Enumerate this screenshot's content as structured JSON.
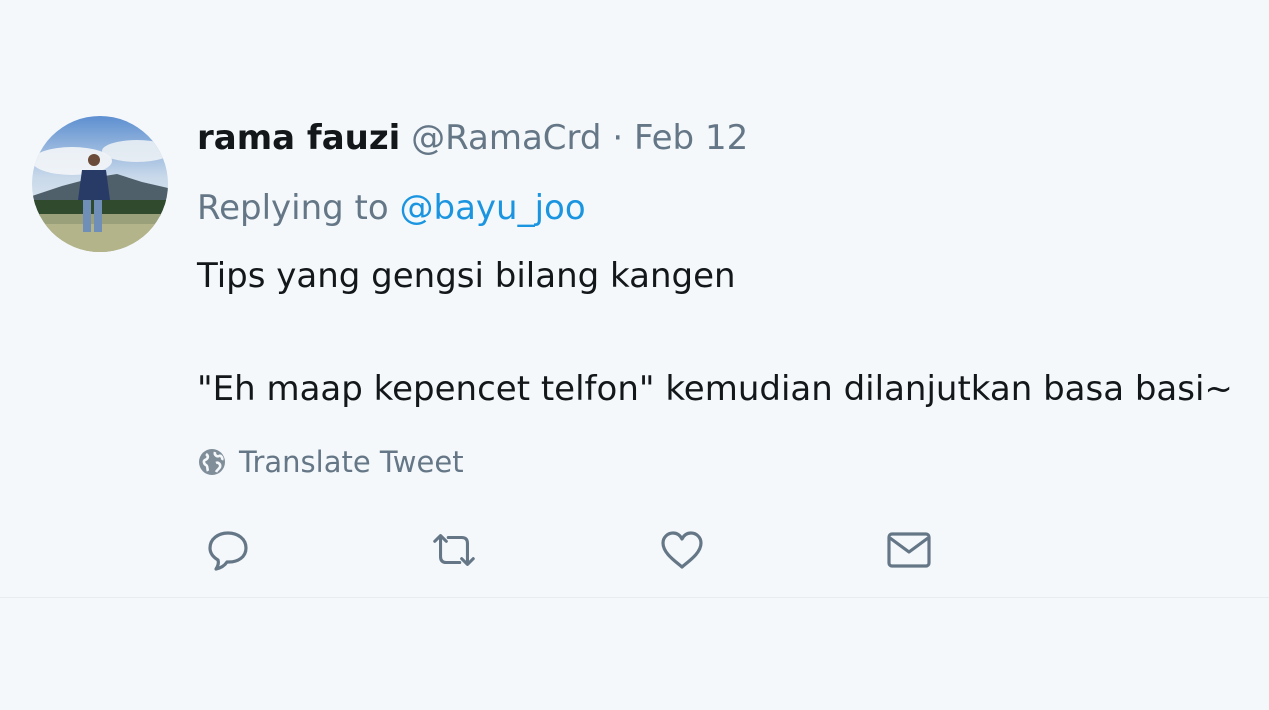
{
  "tweet": {
    "author_name": "rama fauzi",
    "author_handle": "@RamaCrd",
    "separator": "·",
    "date": "Feb 12",
    "reply_prefix": "Replying to",
    "reply_mention": "@bayu_joo",
    "text_line1": "Tips yang gengsi bilang kangen",
    "text_line2": "\"Eh maap kepencet telfon\" kemudian dilanjutkan basa basi~",
    "translate_label": "Translate Tweet"
  },
  "icons": {
    "translate": "globe-icon",
    "reply": "reply-icon",
    "retweet": "retweet-icon",
    "like": "heart-icon",
    "dm": "envelope-icon"
  },
  "colors": {
    "background": "#f4f8fb",
    "text": "#14171a",
    "secondary": "#657786",
    "link": "#1b95e0"
  }
}
